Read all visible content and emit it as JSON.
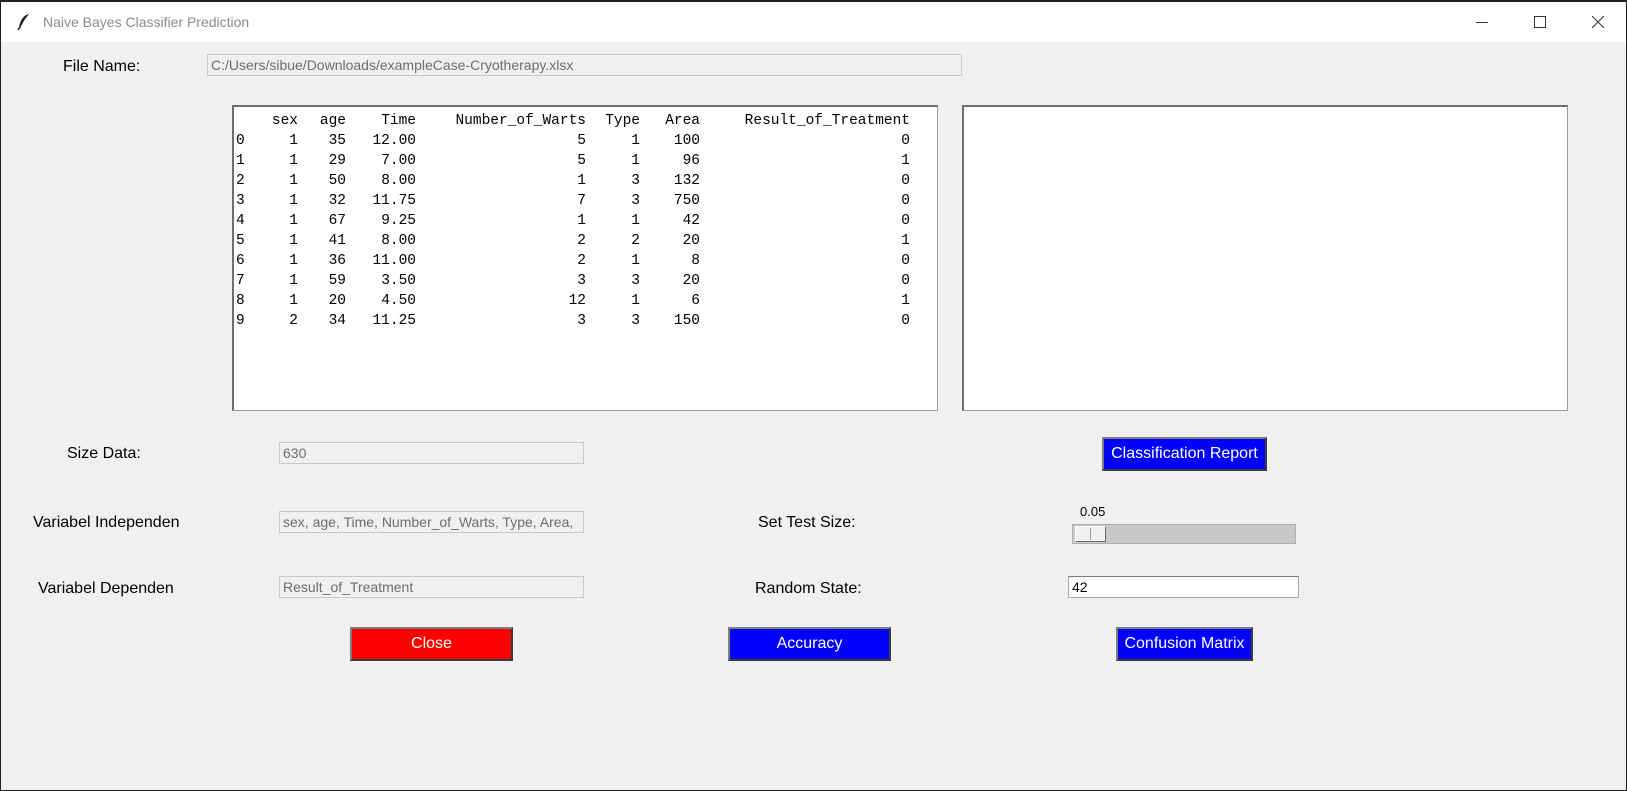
{
  "window": {
    "title": "Naive Bayes Classifier Prediction",
    "icons": {
      "app": "feather-icon",
      "minimize": "minimize-icon",
      "maximize": "maximize-icon",
      "close": "close-icon"
    }
  },
  "file": {
    "label": "File Name:",
    "value": "C:/Users/sibue/Downloads/exampleCase-Cryotherapy.xlsx"
  },
  "table": {
    "columns": [
      "",
      "sex",
      "age",
      "Time",
      "Number_of_Warts",
      "Type",
      "Area",
      "Result_of_Treatment"
    ],
    "rows": [
      [
        "0",
        "1",
        "35",
        "12.00",
        "5",
        "1",
        "100",
        "0"
      ],
      [
        "1",
        "1",
        "29",
        "7.00",
        "5",
        "1",
        "96",
        "1"
      ],
      [
        "2",
        "1",
        "50",
        "8.00",
        "1",
        "3",
        "132",
        "0"
      ],
      [
        "3",
        "1",
        "32",
        "11.75",
        "7",
        "3",
        "750",
        "0"
      ],
      [
        "4",
        "1",
        "67",
        "9.25",
        "1",
        "1",
        "42",
        "0"
      ],
      [
        "5",
        "1",
        "41",
        "8.00",
        "2",
        "2",
        "20",
        "1"
      ],
      [
        "6",
        "1",
        "36",
        "11.00",
        "2",
        "1",
        "8",
        "0"
      ],
      [
        "7",
        "1",
        "59",
        "3.50",
        "3",
        "3",
        "20",
        "0"
      ],
      [
        "8",
        "1",
        "20",
        "4.50",
        "12",
        "1",
        "6",
        "1"
      ],
      [
        "9",
        "2",
        "34",
        "11.25",
        "3",
        "3",
        "150",
        "0"
      ]
    ]
  },
  "report_box": {
    "text": ""
  },
  "size_data": {
    "label": "Size Data:",
    "value": "630"
  },
  "var_independent": {
    "label": "Variabel Independen",
    "value": "sex, age, Time, Number_of_Warts, Type, Area,"
  },
  "var_dependent": {
    "label": "Variabel Dependen",
    "value": "Result_of_Treatment"
  },
  "test_size": {
    "label": "Set Test Size:",
    "value_text": "0.05",
    "value": 0.05
  },
  "random_state": {
    "label": "Random State:",
    "value": "42"
  },
  "buttons": {
    "classification_report": "Classification Report",
    "close": "Close",
    "accuracy": "Accuracy",
    "confusion_matrix": "Confusion Matrix"
  },
  "colors": {
    "primary_button": "#0000ff",
    "danger_button": "#ff0000",
    "background": "#f0f0f0"
  }
}
